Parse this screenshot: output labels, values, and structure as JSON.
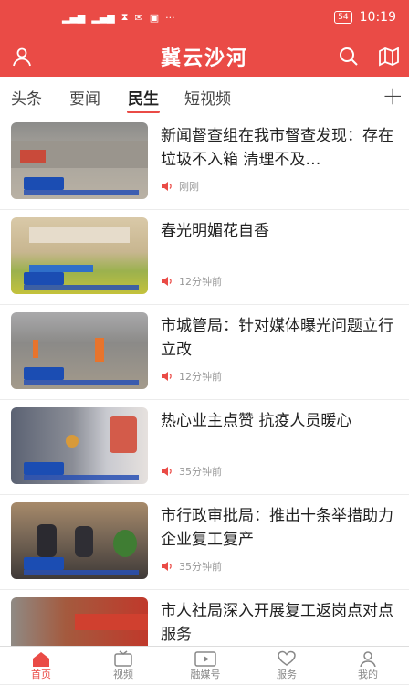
{
  "status": {
    "time": "10:19",
    "battery": "54"
  },
  "app": {
    "title": "冀云沙河"
  },
  "tabs": [
    {
      "label": "头条"
    },
    {
      "label": "要闻"
    },
    {
      "label": "民生"
    },
    {
      "label": "短视频"
    }
  ],
  "articles": [
    {
      "title": "新闻督查组在我市督查发现：存在垃圾不入箱 清理不及…",
      "time": "刚刚"
    },
    {
      "title": "春光明媚花自香",
      "time": "12分钟前"
    },
    {
      "title": "市城管局：针对媒体曝光问题立行立改",
      "time": "12分钟前"
    },
    {
      "title": "热心业主点赞 抗疫人员暖心",
      "time": "35分钟前"
    },
    {
      "title": "市行政审批局：推出十条举措助力企业复工复产",
      "time": "35分钟前"
    },
    {
      "title": "市人社局深入开展复工返岗点对点服务",
      "time": ""
    }
  ],
  "bottom_nav": [
    {
      "label": "首页"
    },
    {
      "label": "视频"
    },
    {
      "label": "融媒号"
    },
    {
      "label": "服务"
    },
    {
      "label": "我的"
    }
  ],
  "colors": {
    "accent": "#ea4b46"
  }
}
